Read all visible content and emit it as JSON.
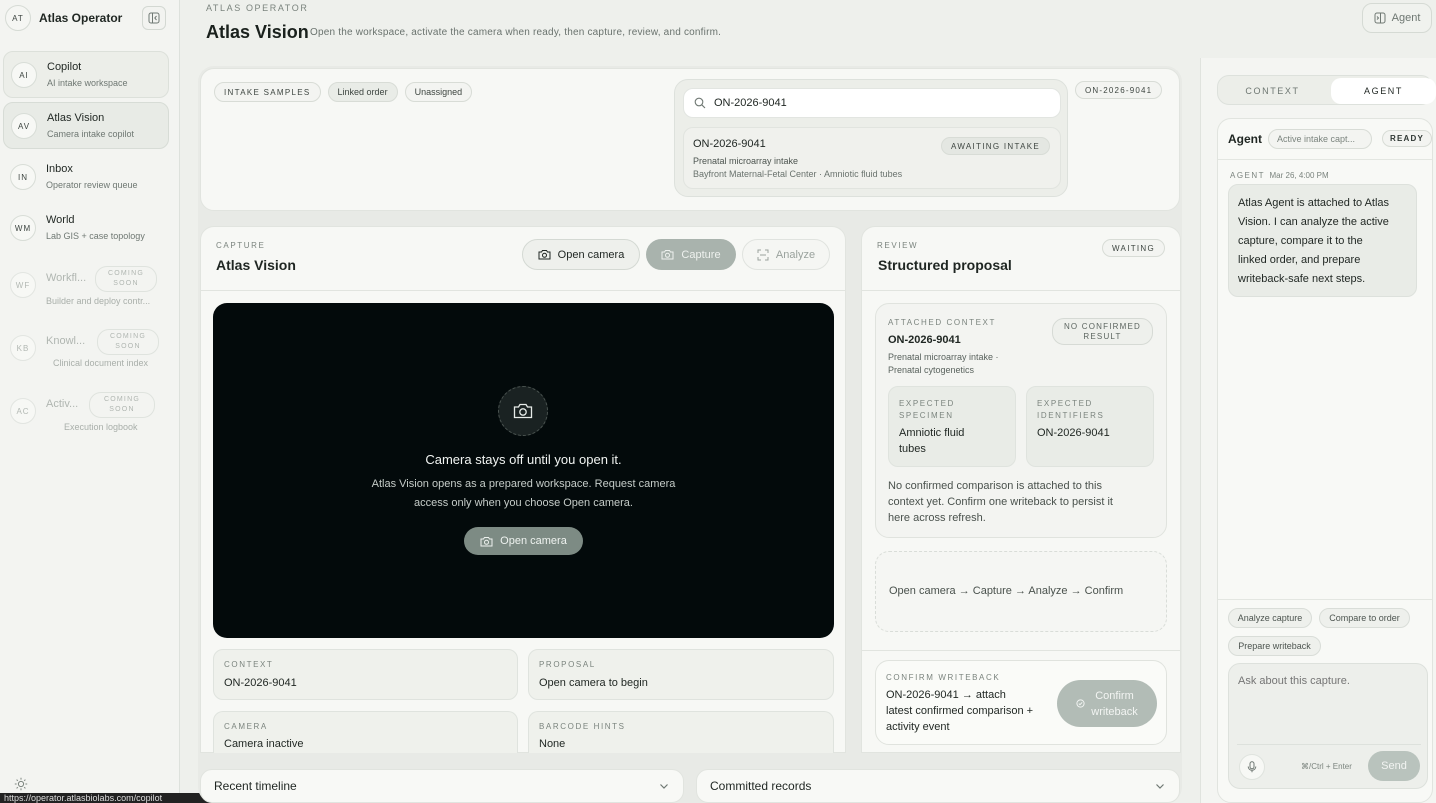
{
  "sidebar": {
    "brand": {
      "badge": "AT",
      "name": "Atlas Operator"
    },
    "items": [
      {
        "badge": "AI",
        "title": "Copilot",
        "subtitle": "AI intake workspace"
      },
      {
        "badge": "AV",
        "title": "Atlas Vision",
        "subtitle": "Camera intake copilot"
      },
      {
        "badge": "IN",
        "title": "Inbox",
        "subtitle": "Operator review queue"
      },
      {
        "badge": "WM",
        "title": "World",
        "subtitle": "Lab GIS + case topology"
      },
      {
        "badge": "WF",
        "title": "Workfl...",
        "subtitle": "Builder and deploy contr...",
        "soon_1": "COMING",
        "soon_2": "SOON"
      },
      {
        "badge": "KB",
        "title": "Knowl...",
        "subtitle": "Clinical document index",
        "soon_1": "COMING",
        "soon_2": "SOON"
      },
      {
        "badge": "AC",
        "title": "Activ...",
        "subtitle": "Execution logbook",
        "soon_1": "COMING",
        "soon_2": "SOON"
      }
    ],
    "status_url": "https://operator.atlasbiolabs.com/copilot"
  },
  "header": {
    "caption": "ATLAS OPERATOR",
    "title": "Atlas Vision",
    "description": "Open the workspace, activate the camera when ready, then capture, review, and confirm.",
    "agent_button": "Agent"
  },
  "intake": {
    "chips": [
      "INTAKE SAMPLES",
      "Linked order",
      "Unassigned"
    ],
    "order_chip": "ON-2026-9041",
    "search_value": "ON-2026-9041",
    "result": {
      "id": "ON-2026-9041",
      "status": "AWAITING INTAKE",
      "line1": "Prenatal microarray intake",
      "line2": "Bayfront Maternal-Fetal Center · Amniotic fluid tubes"
    }
  },
  "capture": {
    "caption": "CAPTURE",
    "title": "Atlas Vision",
    "open_camera": "Open camera",
    "capture": "Capture",
    "analyze": "Analyze",
    "camera_heading": "Camera stays off until you open it.",
    "camera_text_1": "Atlas Vision opens as a prepared workspace. Request camera",
    "camera_text_2": "access only when you choose Open camera.",
    "camera_button": "Open camera",
    "fields": {
      "context_label": "CONTEXT",
      "context_value": "ON-2026-9041",
      "proposal_label": "PROPOSAL",
      "proposal_value": "Open camera to begin",
      "camera_label": "CAMERA",
      "camera_value": "Camera inactive",
      "barcode_label": "BARCODE HINTS",
      "barcode_value": "None"
    }
  },
  "review": {
    "caption": "REVIEW",
    "title": "Structured proposal",
    "status": "WAITING",
    "context_caption": "ATTACHED CONTEXT",
    "context_id": "ON-2026-9041",
    "context_line1": "Prenatal microarray intake ·",
    "context_line2": "Prenatal cytogenetics",
    "no_result_1": "NO CONFIRMED",
    "no_result_2": "RESULT",
    "specimen_label_1": "EXPECTED",
    "specimen_label_2": "SPECIMEN",
    "specimen_value_1": "Amniotic fluid",
    "specimen_value_2": "tubes",
    "identifiers_label_1": "EXPECTED",
    "identifiers_label_2": "IDENTIFIERS",
    "identifiers_value": "ON-2026-9041",
    "note_1": "No confirmed comparison is attached to this",
    "note_2": "context yet. Confirm one writeback to persist it",
    "note_3": "here across refresh.",
    "flow": "Open camera → Capture → Analyze → Confirm",
    "confirm_caption": "CONFIRM WRITEBACK",
    "confirm_1": "ON-2026-9041 → attach",
    "confirm_2": "latest confirmed comparison +",
    "confirm_3": "activity event",
    "confirm_button_1": "Confirm",
    "confirm_button_2": "writeback"
  },
  "bottom": {
    "timeline": "Recent timeline",
    "records": "Committed records"
  },
  "agent_panel": {
    "tab_context": "CONTEXT",
    "tab_agent": "AGENT",
    "title": "Agent",
    "context_chip": "Active intake capt...",
    "status": "READY",
    "msg_label": "AGENT",
    "msg_time": "Mar 26, 4:00 PM",
    "msg_lines": [
      "Atlas Agent is attached to Atlas",
      "Vision. I can analyze the active",
      "capture, compare it to the",
      "linked order, and prepare",
      "writeback-safe next steps."
    ],
    "suggestions": [
      "Analyze capture",
      "Compare to order",
      "Prepare writeback"
    ],
    "composer_placeholder": "Ask about this capture.",
    "shortcut": "⌘/Ctrl + Enter",
    "send": "Send"
  }
}
